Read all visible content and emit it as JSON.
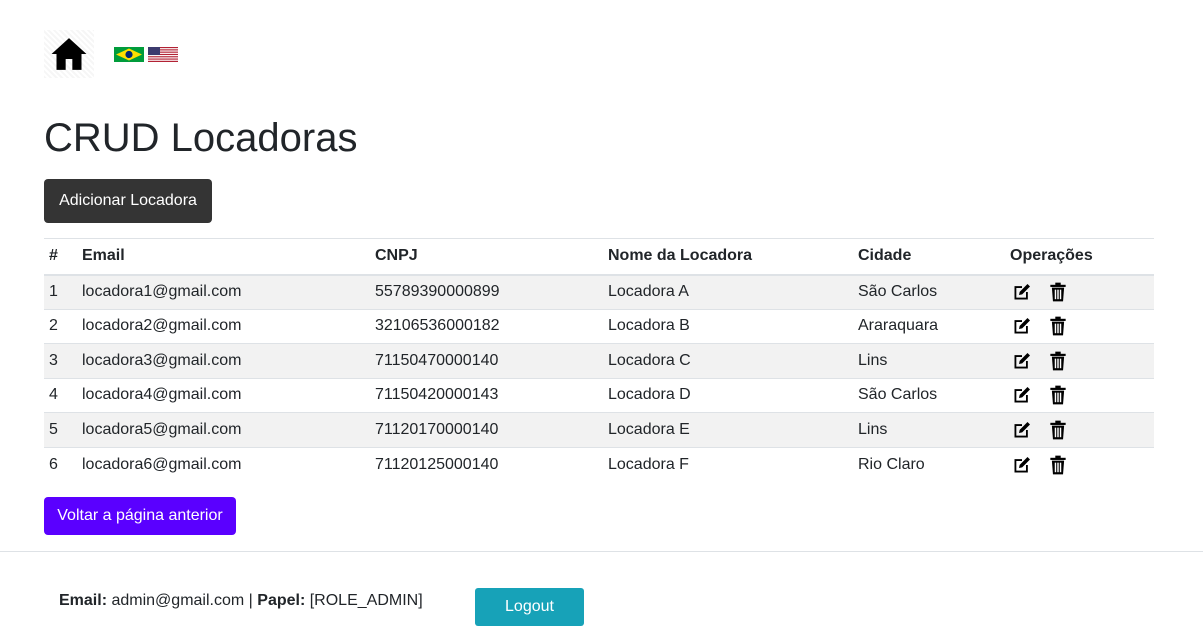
{
  "header": {
    "home_icon": "home-icon",
    "flags": [
      "brazil-flag-icon",
      "usa-flag-icon"
    ]
  },
  "page": {
    "title": "CRUD Locadoras",
    "add_button": "Adicionar Locadora",
    "back_button": "Voltar a página anterior"
  },
  "table": {
    "headers": [
      "#",
      "Email",
      "CNPJ",
      "Nome da Locadora",
      "Cidade",
      "Operações"
    ],
    "rows": [
      {
        "id": "1",
        "email": "locadora1@gmail.com",
        "cnpj": "55789390000899",
        "nome": "Locadora A",
        "cidade": "São Carlos"
      },
      {
        "id": "2",
        "email": "locadora2@gmail.com",
        "cnpj": "32106536000182",
        "nome": "Locadora B",
        "cidade": "Araraquara"
      },
      {
        "id": "3",
        "email": "locadora3@gmail.com",
        "cnpj": "71150470000140",
        "nome": "Locadora C",
        "cidade": "Lins"
      },
      {
        "id": "4",
        "email": "locadora4@gmail.com",
        "cnpj": "71150420000143",
        "nome": "Locadora D",
        "cidade": "São Carlos"
      },
      {
        "id": "5",
        "email": "locadora5@gmail.com",
        "cnpj": "71120170000140",
        "nome": "Locadora E",
        "cidade": "Lins"
      },
      {
        "id": "6",
        "email": "locadora6@gmail.com",
        "cnpj": "71120125000140",
        "nome": "Locadora F",
        "cidade": "Rio Claro"
      }
    ],
    "operation_icons": [
      "edit-icon",
      "trash-icon"
    ]
  },
  "footer": {
    "email_label": "Email:",
    "email_value": "admin@gmail.com",
    "separator": "|",
    "role_label": "Papel:",
    "role_value": "[ROLE_ADMIN]",
    "logout_button": "Logout"
  },
  "colors": {
    "add_button_bg": "#343434",
    "back_button_bg": "#5a00ff",
    "logout_button_bg": "#17a2b8",
    "stripe_bg": "#f2f2f2"
  }
}
